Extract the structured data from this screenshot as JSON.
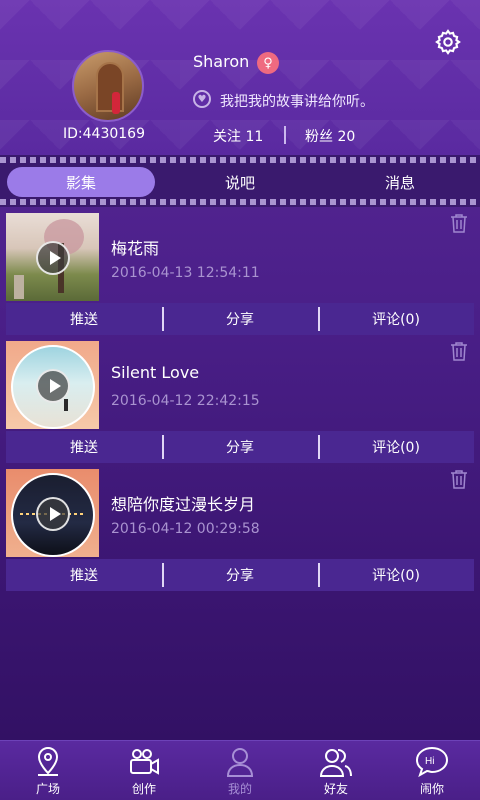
{
  "profile": {
    "name": "Sharon",
    "gender_symbol": "♀",
    "signature": "我把我的故事讲给你听。",
    "id_text": "ID:4430169",
    "follow_text": "关注 11",
    "fans_text": "粉丝 20"
  },
  "tabs": [
    {
      "label": "影集",
      "active": true
    },
    {
      "label": "说吧",
      "active": false
    },
    {
      "label": "消息",
      "active": false
    }
  ],
  "posts": [
    {
      "title": "梅花雨",
      "date": "2016-04-13 12:54:11",
      "actions": [
        "推送",
        "分享",
        "评论(0)"
      ]
    },
    {
      "title": "Silent Love",
      "date": "2016-04-12 22:42:15",
      "actions": [
        "推送",
        "分享",
        "评论(0)"
      ]
    },
    {
      "title": "想陪你度过漫长岁月",
      "date": "2016-04-12 00:29:58",
      "actions": [
        "推送",
        "分享",
        "评论(0)"
      ]
    }
  ],
  "nav": [
    {
      "label": "广场",
      "icon": "location-pin-icon"
    },
    {
      "label": "创作",
      "icon": "video-camera-icon"
    },
    {
      "label": "我的",
      "icon": "person-icon",
      "active": true
    },
    {
      "label": "好友",
      "icon": "friends-icon"
    },
    {
      "label": "闹你",
      "icon": "hi-bubble-icon"
    }
  ],
  "colors": {
    "background": "#4a1f88",
    "active_tab": "#9b7be8",
    "gender_badge": "#ef6a80",
    "action_bar": "#4a2791"
  }
}
